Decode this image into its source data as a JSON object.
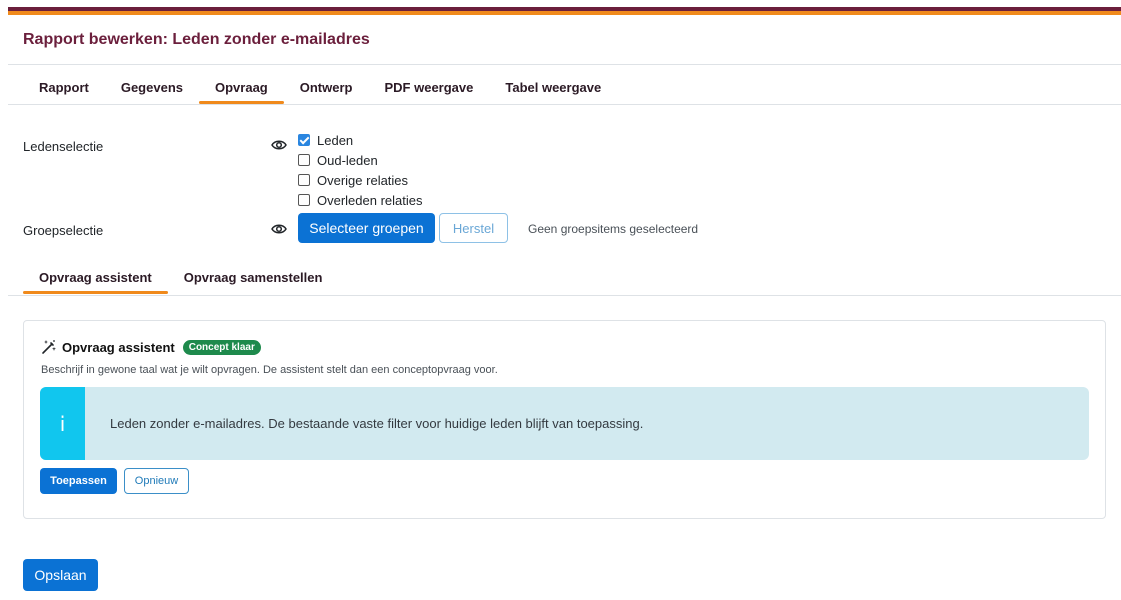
{
  "header": {
    "title": "Rapport bewerken: Leden zonder e-mailadres"
  },
  "main_tabs": [
    {
      "label": "Rapport",
      "active": false
    },
    {
      "label": "Gegevens",
      "active": false
    },
    {
      "label": "Opvraag",
      "active": true
    },
    {
      "label": "Ontwerp",
      "active": false
    },
    {
      "label": "PDF weergave",
      "active": false
    },
    {
      "label": "Tabel weergave",
      "active": false
    }
  ],
  "ledenselectie": {
    "label": "Ledenselectie",
    "icon": "eye-icon",
    "options": [
      {
        "label": "Leden",
        "checked": true
      },
      {
        "label": "Oud-leden",
        "checked": false
      },
      {
        "label": "Overige relaties",
        "checked": false
      },
      {
        "label": "Overleden relaties",
        "checked": false
      }
    ]
  },
  "groepselectie": {
    "label": "Groepselectie",
    "icon": "eye-icon",
    "select_button": "Selecteer groepen",
    "reset_button": "Herstel",
    "status": "Geen groepsitems geselecteerd"
  },
  "sub_tabs": [
    {
      "label": "Opvraag assistent",
      "active": true
    },
    {
      "label": "Opvraag samenstellen",
      "active": false
    }
  ],
  "assistant": {
    "icon": "magic-wand-icon",
    "title": "Opvraag assistent",
    "badge": "Concept klaar",
    "description": "Beschrijf in gewone taal wat je wilt opvragen. De assistent stelt dan een conceptopvraag voor.",
    "info_icon": "i",
    "info_text": "Leden zonder e-mailadres. De bestaande vaste filter voor huidige leden blijft van toepassing.",
    "apply_button": "Toepassen",
    "again_button": "Opnieuw"
  },
  "save_button": "Opslaan",
  "colors": {
    "brand": "#6b1f3c",
    "accent": "#f08a1c",
    "primary": "#0b72d4",
    "badge": "#1e8a4c",
    "info": "#11c6ee"
  }
}
